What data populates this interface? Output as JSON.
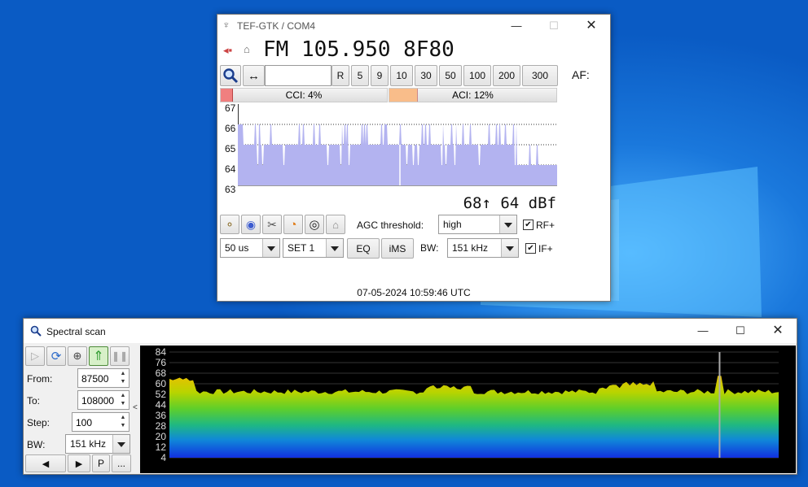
{
  "tef": {
    "title": "TEF-GTK / COM4",
    "freq_display": "FM 105.950 8F80",
    "af_label": "AF:",
    "step_buttons": [
      "R",
      "5",
      "9",
      "10",
      "30",
      "50",
      "100",
      "200",
      "300"
    ],
    "cci_label": "CCI: 4%",
    "aci_label": "ACI: 12%",
    "cci_level": 0.04,
    "aci_level": 0.12,
    "graph_y_ticks": [
      "67",
      "66",
      "65",
      "64",
      "63"
    ],
    "signal_readout": "68↑ 64 dBf",
    "agc_label": "AGC threshold:",
    "agc_value": "high",
    "rf_label": "RF+",
    "if_label": "IF+",
    "deemphasis_value": "50 us",
    "set_value": "SET 1",
    "eq_label": "EQ",
    "ims_label": "iMS",
    "bw_label": "BW:",
    "bw_value": "151 kHz",
    "timestamp": "07-05-2024 10:59:46 UTC",
    "colors": {
      "graph_fill": "#b3b3f0",
      "cci": "#f07f7f",
      "aci": "#f9bd8a"
    }
  },
  "scan": {
    "title": "Spectral scan",
    "from_label": "From:",
    "from_value": "87500",
    "to_label": "To:",
    "to_value": "108000",
    "step_label": "Step:",
    "step_value": "100",
    "bw_label": "BW:",
    "bw_value": "151 kHz",
    "p_label": "P",
    "more_label": "...",
    "collapse_label": "<",
    "y_ticks": [
      "84",
      "76",
      "68",
      "60",
      "52",
      "44",
      "36",
      "28",
      "20",
      "12",
      "4"
    ]
  }
}
